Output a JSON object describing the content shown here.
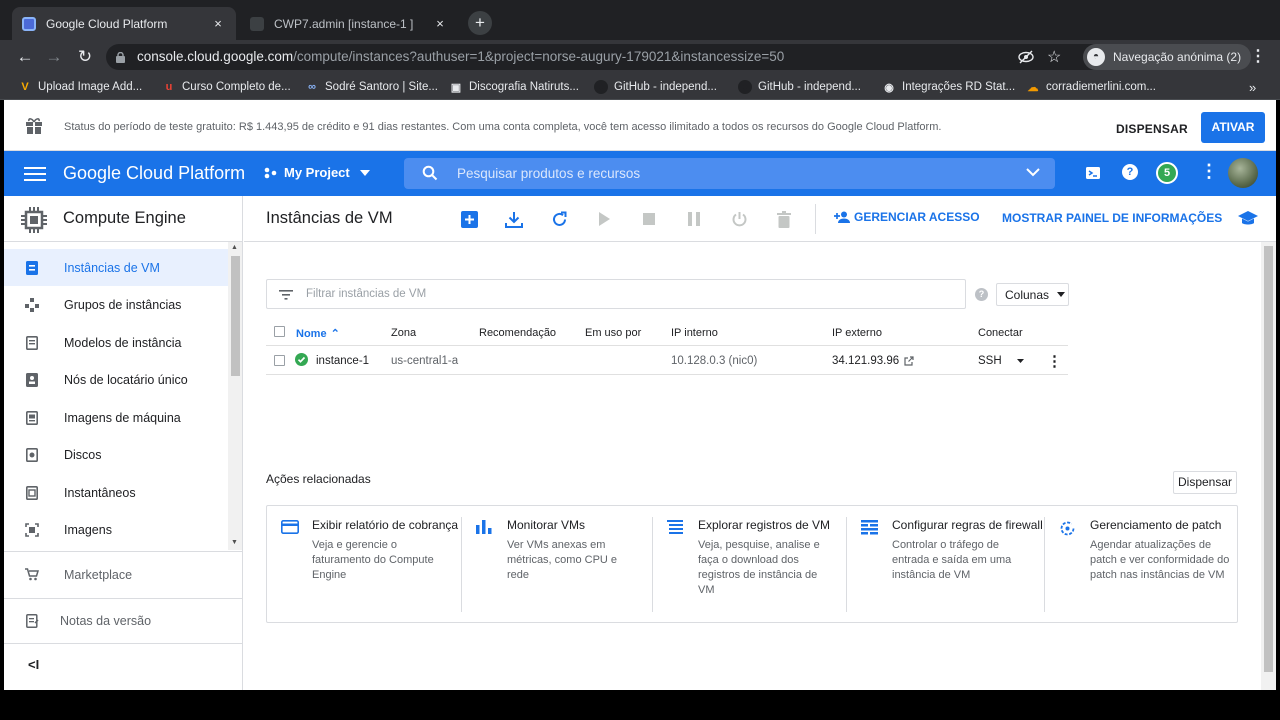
{
  "browser": {
    "tabs": [
      {
        "title": "Google Cloud Platform",
        "active": true,
        "close": "×"
      },
      {
        "title": "CWP7.admin [instance-1 ]",
        "active": false,
        "close": "×"
      }
    ],
    "new_tab": "+",
    "url_host": "console.cloud.google.com",
    "url_path": "/compute/instances?authuser=1&project=norse-augury-179021&instancessize=50",
    "incognito": "Navegação anónima (2)",
    "bookmarks": [
      {
        "label": "Upload Image Add...",
        "icon": "V",
        "color": "#f9ab00"
      },
      {
        "label": "Curso Completo de...",
        "icon": "u",
        "color": "#ea4335"
      },
      {
        "label": "Sodré Santoro | Site...",
        "icon": "∞",
        "color": "#8ab4f8"
      },
      {
        "label": "Discografia Natiruts...",
        "icon": "▣",
        "color": "#e8eaed"
      },
      {
        "label": "GitHub - independ...",
        "icon": "●",
        "color": "#202124"
      },
      {
        "label": "GitHub - independ...",
        "icon": "●",
        "color": "#202124"
      },
      {
        "label": "Integrações RD Stat...",
        "icon": "◉",
        "color": "#e8eaed"
      },
      {
        "label": "corradiemerlini.com...",
        "icon": "☁",
        "color": "#f29900"
      }
    ],
    "bookmarks_more": "»"
  },
  "trial_banner": {
    "text": "Status do período de teste gratuito: R$ 1.443,95 de crédito e 91 dias restantes. Com uma conta completa, você tem acesso ilimitado a todos os recursos do Google Cloud Platform.",
    "dismiss": "DISPENSAR",
    "activate": "ATIVAR"
  },
  "topbar": {
    "brand": "Google Cloud Platform",
    "project": "My Project",
    "search_placeholder": "Pesquisar produtos e recursos",
    "notifications": "5",
    "accent": "#1a73e8"
  },
  "sidebar": {
    "title": "Compute Engine",
    "items": [
      {
        "label": "Instâncias de VM",
        "active": true
      },
      {
        "label": "Grupos de instâncias"
      },
      {
        "label": "Modelos de instância"
      },
      {
        "label": "Nós de locatário único"
      },
      {
        "label": "Imagens de máquina"
      },
      {
        "label": "Discos"
      },
      {
        "label": "Instantâneos"
      },
      {
        "label": "Imagens"
      }
    ],
    "marketplace": "Marketplace",
    "release_notes": "Notas da versão",
    "collapse": "<I"
  },
  "main": {
    "title": "Instâncias de VM",
    "manage_access": "GERENCIAR ACESSO",
    "show_info_panel": "MOSTRAR PAINEL DE INFORMAÇÕES",
    "filter_placeholder": "Filtrar instâncias de VM",
    "columns_button": "Colunas",
    "table": {
      "headers": [
        "Nome",
        "Zona",
        "Recomendação",
        "Em uso por",
        "IP interno",
        "IP externo",
        "Conectar"
      ],
      "rows": [
        {
          "name": "instance-1",
          "zone": "us-central1-a",
          "recommendation": "",
          "in_use_by": "",
          "internal_ip": "10.128.0.3 (nic0)",
          "external_ip": "34.121.93.96",
          "connect": "SSH",
          "status": "running"
        }
      ]
    },
    "related": {
      "title": "Ações relacionadas",
      "dismiss": "Dispensar",
      "cards": [
        {
          "title": "Exibir relatório de cobrança",
          "desc": "Veja e gerencie o faturamento do Compute Engine",
          "icon": "billing-icon"
        },
        {
          "title": "Monitorar VMs",
          "desc": "Ver VMs anexas em métricas, como CPU e rede",
          "icon": "monitoring-icon"
        },
        {
          "title": "Explorar registros de VM",
          "desc": "Veja, pesquise, analise e faça o download dos registros de instância de VM",
          "icon": "logs-icon"
        },
        {
          "title": "Configurar regras de firewall",
          "desc": "Controlar o tráfego de entrada e saída em uma instância de VM",
          "icon": "firewall-icon"
        },
        {
          "title": "Gerenciamento de patch",
          "desc": "Agendar atualizações de patch e ver conformidade do patch nas instâncias de VM",
          "icon": "patch-icon"
        }
      ]
    }
  }
}
